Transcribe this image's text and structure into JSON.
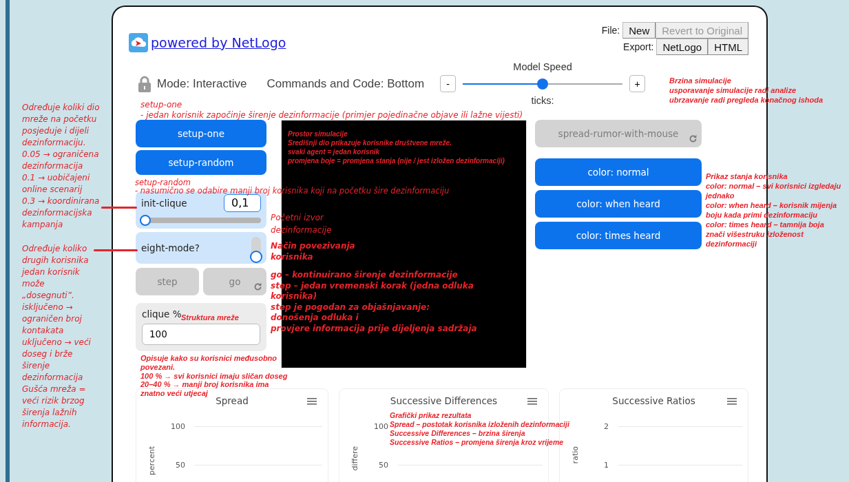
{
  "sidebar_notes": [
    "Određuje koliki dio mreže na početku posjeduje i dijeli dezinformaciju.\n0.05 → ograničena dezinformacija\n0.1 → uobičajeni online scenarij\n0.3 → koordinirana dezinformacijska kampanja",
    "Određuje koliko drugih korisnika jedan korisnik može „dosegnuti”.\nisključeno → ograničen broj kontakata\nuključeno → veći doseg i brže širenje dezinformacija\nGušća mreža = veći rizik brzog širenja lažnih informacija."
  ],
  "header": {
    "link": "powered by NetLogo",
    "file_label": "File:",
    "file_buttons": [
      {
        "label": "New",
        "disabled": false
      },
      {
        "label": "Revert to Original",
        "disabled": true
      }
    ],
    "export_label": "Export:",
    "export_buttons": [
      {
        "label": "NetLogo",
        "disabled": false
      },
      {
        "label": "HTML",
        "disabled": false
      }
    ]
  },
  "toolbar": {
    "mode": "Mode: Interactive",
    "commands": "Commands and Code: Bottom",
    "speed_label": "Model Speed",
    "minus": "-",
    "plus": "+",
    "level": 0.5,
    "ticks": "ticks:"
  },
  "left_widgets": [
    {
      "kind": "button",
      "label": "setup-one",
      "disabled": false,
      "forever": false
    },
    {
      "kind": "button",
      "label": "setup-random",
      "disabled": false,
      "forever": false
    },
    {
      "kind": "slider",
      "label": "init-clique",
      "value": "0,1",
      "level": 0
    },
    {
      "kind": "switch",
      "label": "eight-mode?",
      "on": false
    },
    {
      "kind": "row",
      "buttons": [
        {
          "label": "step",
          "disabled": true,
          "forever": false
        },
        {
          "label": "go",
          "disabled": true,
          "forever": true
        }
      ]
    },
    {
      "kind": "input",
      "label": "clique %",
      "value": "100"
    }
  ],
  "right_widgets": [
    {
      "label": "spread-rumor-with-mouse",
      "disabled": true,
      "forever": true
    },
    {
      "label": "color: normal",
      "disabled": false,
      "forever": false
    },
    {
      "label": "color: when heard",
      "disabled": false,
      "forever": false
    },
    {
      "label": "color: times heard",
      "disabled": false,
      "forever": false
    }
  ],
  "plots": [
    {
      "title": "Spread",
      "ylabel": "percent",
      "yticks": [
        "100",
        "50"
      ]
    },
    {
      "title": "Successive Differences",
      "ylabel": "differe",
      "yticks": [
        "100",
        "50"
      ]
    },
    {
      "title": "Successive Ratios",
      "ylabel": "ratio",
      "yticks": [
        "2",
        "1"
      ]
    }
  ],
  "notes": [
    "Brzina simulacije\nusporavanje simulacije radi analize\nubrzavanje radi pregleda konačnog ishoda",
    "setup-one\n- jedan korisnik započinje širenje dezinformacije (primjer pojedinačne objave ili lažne vijesti)",
    "Prostor simulacije\nSredišnji dio prikazuje korisnike društvene mreže.\nsvaki agent = jedan korisnik\npromjena boje = promjena stanja (nije / jest izložen dezinformaciji)",
    "setup-random\n- nasumično se odabire manji broj korisnika koji na početku šire dezinformaciju",
    "Prikaz stanja korisnika\ncolor: normal – svi korisnici izgledaju\njednako\ncolor: when heard – korisnik mijenja\nboju kada primi dezinformaciju\ncolor: times heard – tamnija boja\nznači višestruku izloženost\ndezinformaciji",
    "Početni izvor\ndezinformacije",
    "Način povezivanja\nkorisnika",
    "go – kontinuirano širenje dezinformacije\nstep – jedan vremenski korak (jedna odluka\nkorisnika)\nstep je pogodan za objašnjavanje:\ndonošenja odluka i\nprovjere informacija prije dijeljenja sadržaja",
    "Struktura mreže",
    "Opisuje kako su korisnici međusobno\npovezani.\n100 % → svi korisnici imaju sličan doseg\n20–40 % → manji broj korisnika ima\nznatno veći utjecaj",
    "Grafički prikaz rezultata\nSpread – postotak korisnika izloženih dezinformaciji\nSuccessive Differences – brzina širenja\nSuccessive Ratios – promjena širenja kroz vrijeme"
  ]
}
